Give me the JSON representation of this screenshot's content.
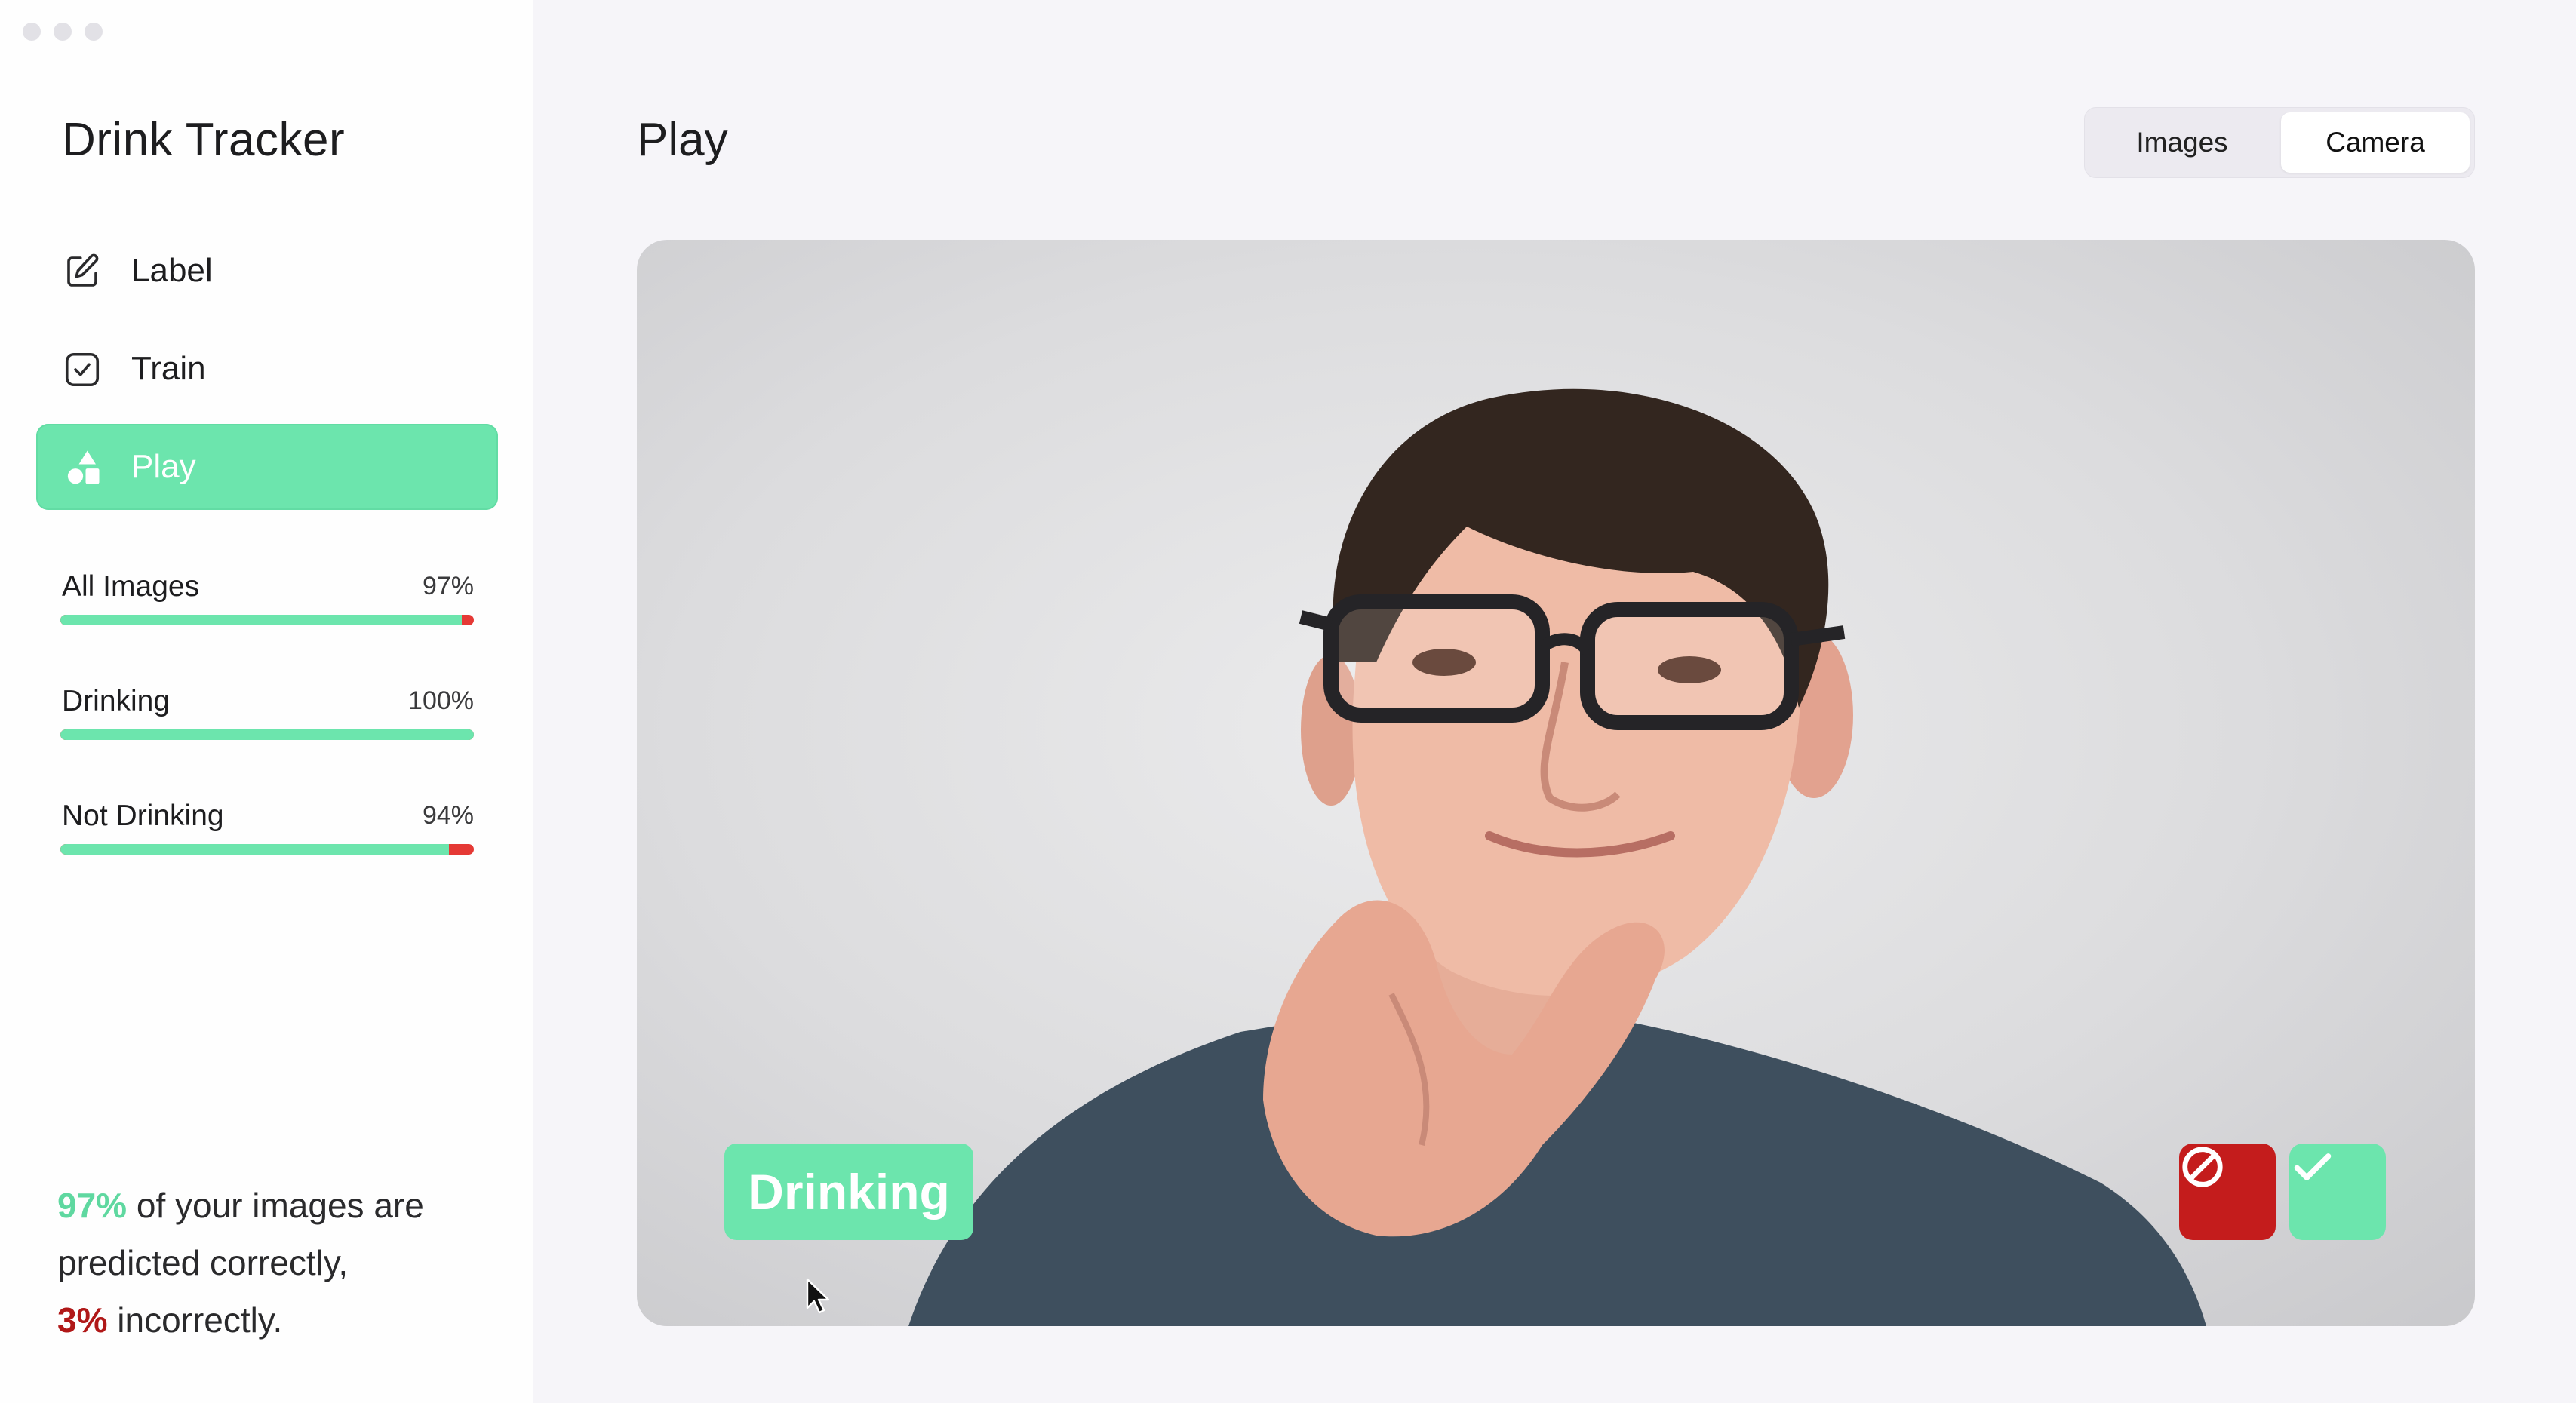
{
  "app": {
    "title": "Drink Tracker"
  },
  "nav": [
    {
      "label": "Label",
      "icon": "pencil-square-icon"
    },
    {
      "label": "Train",
      "icon": "check-square-icon"
    },
    {
      "label": "Play",
      "icon": "shapes-icon",
      "active": true
    }
  ],
  "stats": [
    {
      "name": "All Images",
      "percent": "97%",
      "value": 0.97
    },
    {
      "name": "Drinking",
      "percent": "100%",
      "value": 1.0
    },
    {
      "name": "Not Drinking",
      "percent": "94%",
      "value": 0.94
    }
  ],
  "summary": {
    "correct_pct": "97%",
    "correct_text": " of your images are predicted correctly,",
    "incorrect_pct": "3%",
    "incorrect_text": " incorrectly."
  },
  "main": {
    "title": "Play",
    "mode_options": [
      "Images",
      "Camera"
    ],
    "selected_mode": "Camera",
    "prediction": "Drinking"
  },
  "colors": {
    "accent": "#6ce5ad",
    "error": "#c41c1c"
  }
}
